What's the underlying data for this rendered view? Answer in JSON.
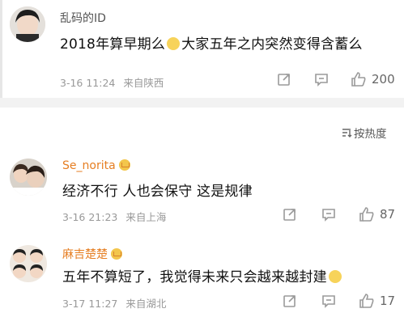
{
  "top_post": {
    "username": "乱码的ID",
    "content_before": "2018年算早期么",
    "content_after": "大家五年之内突然变得含蓄么",
    "time": "3-16 11:24",
    "location": "来自陕西",
    "like_count": "200",
    "icons": [
      "share-icon",
      "comment-icon",
      "like-icon"
    ]
  },
  "sort_label": "按热度",
  "comments": [
    {
      "username": "Se_norita",
      "content": "经济不行 人也会保守 这是规律",
      "time": "3-16 21:23",
      "location": "来自上海",
      "like_count": "87"
    },
    {
      "username": "麻吉楚楚",
      "content": "五年不算短了，我觉得未来只会越来越封建",
      "time": "3-17 11:27",
      "location": "来自湖北",
      "like_count": "17"
    }
  ],
  "colors": {
    "vip_name": "#e67e22",
    "meta_text": "#999999",
    "divider": "#f2f2f2"
  }
}
